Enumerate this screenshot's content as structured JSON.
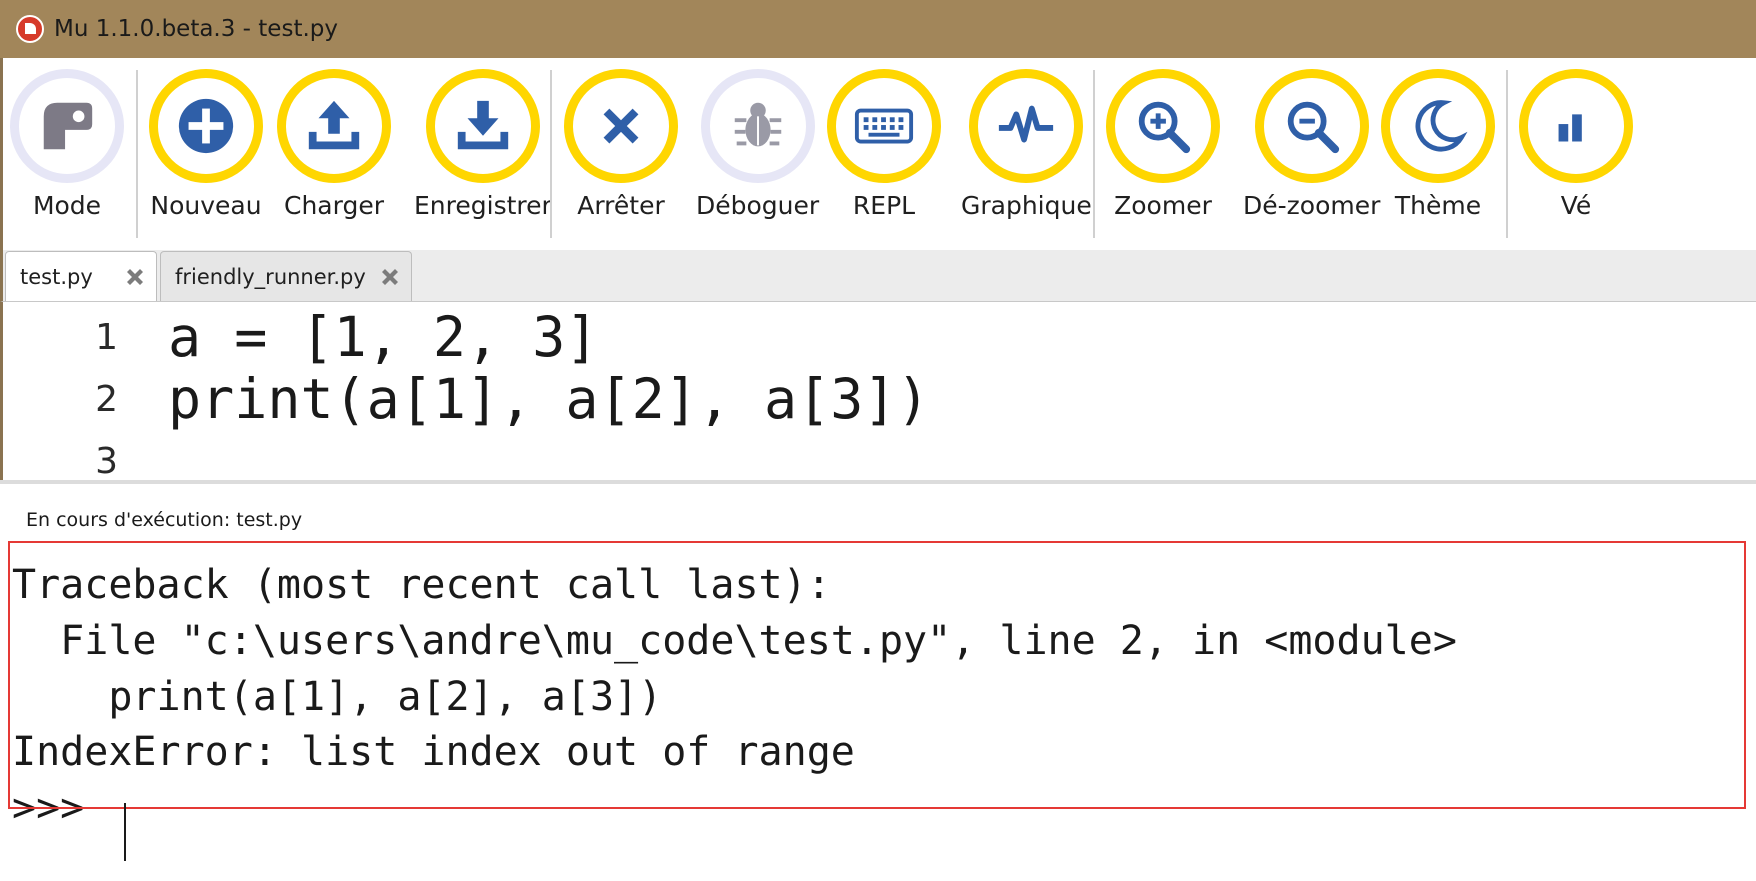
{
  "window": {
    "title": "Mu 1.1.0.beta.3 - test.py"
  },
  "toolbar": {
    "mode": "Mode",
    "new": "Nouveau",
    "load": "Charger",
    "save": "Enregistrer",
    "stop": "Arrêter",
    "debug": "Déboguer",
    "repl": "REPL",
    "plotter": "Graphique",
    "zoom_in": "Zoomer",
    "zoom_out": "Dé-zoomer",
    "theme": "Thème",
    "check": "Vé"
  },
  "tabs": [
    {
      "label": "test.py",
      "active": true
    },
    {
      "label": "friendly_runner.py",
      "active": false
    }
  ],
  "editor": {
    "lines": [
      {
        "number": "1",
        "code": "a = [1, 2, 3]"
      },
      {
        "number": "2",
        "code": "print(a[1], a[2], a[3])"
      },
      {
        "number": "3",
        "code": ""
      }
    ]
  },
  "status": {
    "running": "En cours d'exécution: test.py"
  },
  "repl": {
    "lines": [
      "Traceback (most recent call last):",
      "  File \"c:\\users\\andre\\mu_code\\test.py\", line 2, in <module>",
      "    print(a[1], a[2], a[3])",
      "IndexError: list index out of range"
    ],
    "prompt": ">>> "
  },
  "colors": {
    "titlebar": "#a2865a",
    "button_ring": "#ffd600",
    "button_ring_inactive": "#e6e6f6",
    "icon_blue": "#2f5fa8",
    "highlight_border": "#e53935"
  }
}
